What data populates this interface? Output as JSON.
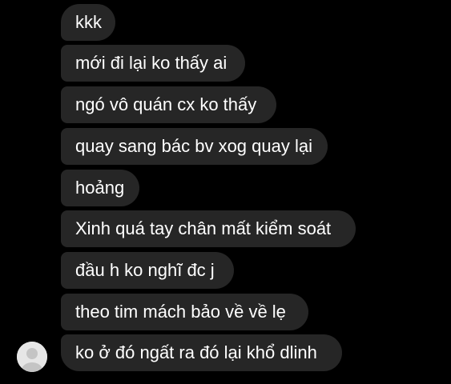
{
  "messages": [
    {
      "text": "kkk"
    },
    {
      "text": "mới đi lại ko thấy ai"
    },
    {
      "text": "ngó vô quán cx ko thấy"
    },
    {
      "text": "quay sang bác bv xog quay lại"
    },
    {
      "text": "hoảng"
    },
    {
      "text": "Xinh quá tay chân mất kiểm soát"
    },
    {
      "text": "đầu h ko nghĩ đc j"
    },
    {
      "text": "theo tim mách bảo về về lẹ"
    },
    {
      "text": "ko ở đó ngất ra đó lại khổ dlinh"
    }
  ],
  "colors": {
    "background": "#000000",
    "bubble": "#262626",
    "text": "#ffffff",
    "avatar": "#e8e8e8"
  },
  "avatar": {
    "icon": "default-user-avatar-icon"
  }
}
